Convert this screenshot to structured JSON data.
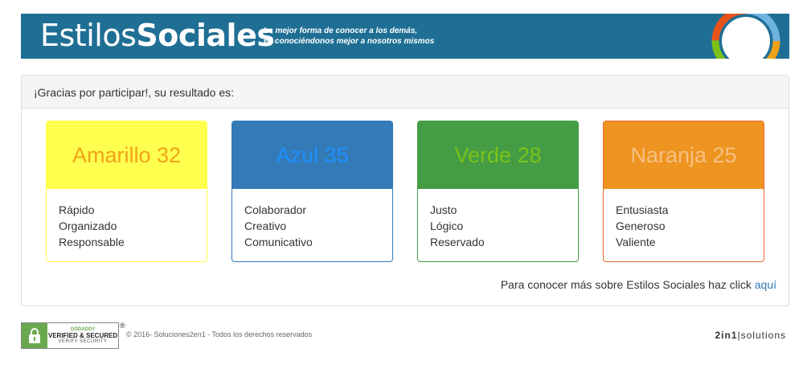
{
  "header": {
    "brand_light": "Estilos",
    "brand_bold": "Sociales",
    "tagline_line1": "La mejor forma de conocer a los demás,",
    "tagline_line2": "es conociéndonos mejor a nosotros mismos"
  },
  "panel": {
    "heading": "¡Gracias por participar!, su resultado es:",
    "more_text": "Para conocer más sobre Estilos Sociales haz click",
    "more_link": "aquí"
  },
  "cards": [
    {
      "title": "Amarillo 32",
      "traits": [
        "Rápido",
        "Organizado",
        "Responsable"
      ],
      "head_bg": "#ffff4d",
      "title_color": "#f0a21a",
      "border": "#ffff4d"
    },
    {
      "title": "Azul 35",
      "traits": [
        "Colaborador",
        "Creativo",
        "Comunicativo"
      ],
      "head_bg": "#337ab7",
      "title_color": "#1e90ff",
      "border": "#337ab7"
    },
    {
      "title": "Verde 28",
      "traits": [
        "Justo",
        "Lógico",
        "Reservado"
      ],
      "head_bg": "#449d44",
      "title_color": "#7cc21a",
      "border": "#449d44"
    },
    {
      "title": "Naranja 25",
      "traits": [
        "Entusiasta",
        "Generoso",
        "Valiente"
      ],
      "head_bg": "#ee9420",
      "title_color": "#f6c085",
      "border": "#ec6a2c"
    }
  ],
  "footer": {
    "badge_top": "GODADDY",
    "badge_mid": "VERIFIED & SECURED",
    "badge_bot": "VERIFY SECURITY",
    "registered": "®",
    "copyright": "© 2016- Soluciones2en1 - Todos los derechos reservados",
    "company_bold": "2in1",
    "company_rest": "|solutions"
  }
}
